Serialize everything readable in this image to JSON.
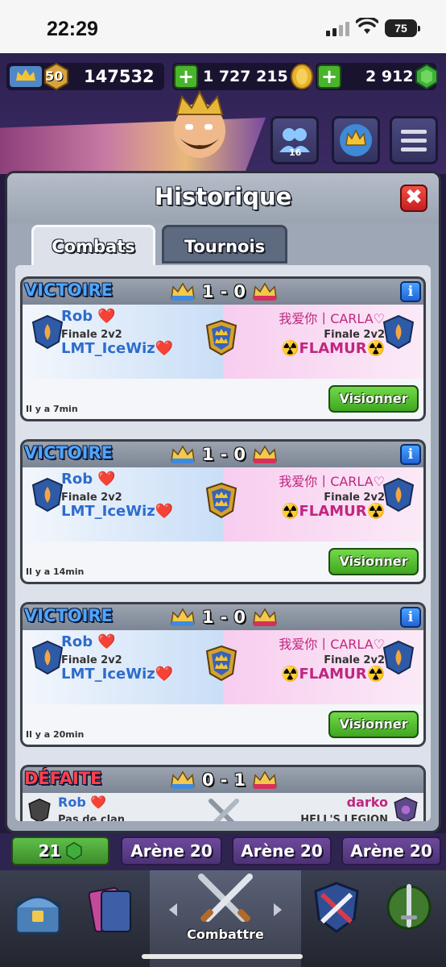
{
  "status_bar": {
    "time": "22:29",
    "battery": "75"
  },
  "header": {
    "level": "50",
    "trophies": "147532",
    "gold": "1 727 215",
    "gems": "2 912",
    "friends_count": "16",
    "plus_symbol": "+"
  },
  "modal": {
    "title": "Historique",
    "close_symbol": "✖",
    "tabs": {
      "combats": "Combats",
      "tournois": "Tournois"
    }
  },
  "battles": [
    {
      "result": "VICTOIRE",
      "score_left": "1",
      "score_sep": "-",
      "score_right": "0",
      "left_player": "Rob ❤️",
      "left_subtitle": "Finale 2v2",
      "left_teammate": "LMT_IceWiz❤️",
      "right_player": "我爱你丨CARLA♡",
      "right_subtitle": "Finale 2v2",
      "right_teammate": "☢️FLAMUR☢️",
      "time": "Il y a 7min",
      "replay": "Visionner",
      "info": "i"
    },
    {
      "result": "VICTOIRE",
      "score_left": "1",
      "score_sep": "-",
      "score_right": "0",
      "left_player": "Rob ❤️",
      "left_subtitle": "Finale 2v2",
      "left_teammate": "LMT_IceWiz❤️",
      "right_player": "我爱你丨CARLA♡",
      "right_subtitle": "Finale 2v2",
      "right_teammate": "☢️FLAMUR☢️",
      "time": "Il y a 14min",
      "replay": "Visionner",
      "info": "i"
    },
    {
      "result": "VICTOIRE",
      "score_left": "1",
      "score_sep": "-",
      "score_right": "0",
      "left_player": "Rob ❤️",
      "left_subtitle": "Finale 2v2",
      "left_teammate": "LMT_IceWiz❤️",
      "right_player": "我爱你丨CARLA♡",
      "right_subtitle": "Finale 2v2",
      "right_teammate": "☢️FLAMUR☢️",
      "time": "Il y a 20min",
      "replay": "Visionner",
      "info": "i"
    },
    {
      "result": "DÉFAITE",
      "score_left": "0",
      "score_sep": "-",
      "score_right": "1",
      "left_player": "Rob ❤️",
      "left_subtitle": "Pas de clan",
      "right_player": "darko",
      "right_subtitle": "HELL'S LEGION"
    }
  ],
  "bottom": {
    "gems_chip": "21",
    "arenas": [
      "Arène 20",
      "Arène 20",
      "Arène 20"
    ],
    "nav_active_label": "Combattre"
  },
  "colors": {
    "victory": "#4ea6ff",
    "defeat": "#ff3f4d",
    "replay_button": "#3fa620",
    "close_button": "#c61f1f"
  }
}
